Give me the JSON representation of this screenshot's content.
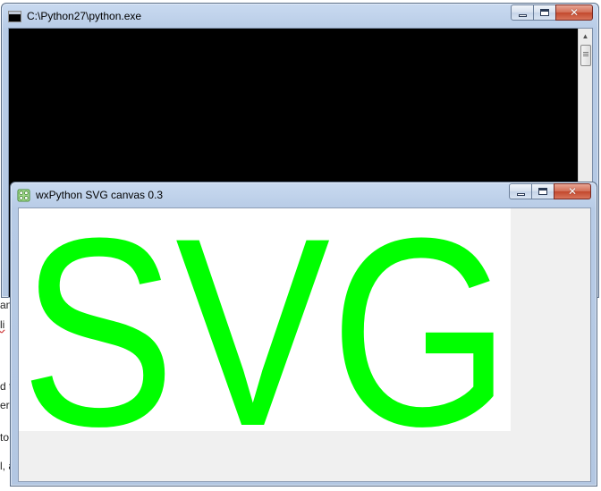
{
  "background_fragments": [
    {
      "text": "an"
    },
    {
      "text": "li"
    },
    {
      "text": "d t"
    },
    {
      "text": "ers"
    },
    {
      "text": "to"
    },
    {
      "text": "l, a"
    }
  ],
  "console_window": {
    "title": "C:\\Python27\\python.exe",
    "icon": "cmd-icon",
    "minimize_icon": "minimize-icon",
    "maximize_icon": "maximize-icon",
    "close_icon": "close-icon",
    "close_glyph": "✕",
    "background": "#000000"
  },
  "svg_window": {
    "title": "wxPython SVG canvas 0.3",
    "icon": "wxpython-icon",
    "minimize_icon": "minimize-icon",
    "maximize_icon": "maximize-icon",
    "close_icon": "close-icon",
    "close_glyph": "✕",
    "canvas": {
      "text": "SVG",
      "fill": "#00ff00",
      "background": "#ffffff"
    }
  }
}
